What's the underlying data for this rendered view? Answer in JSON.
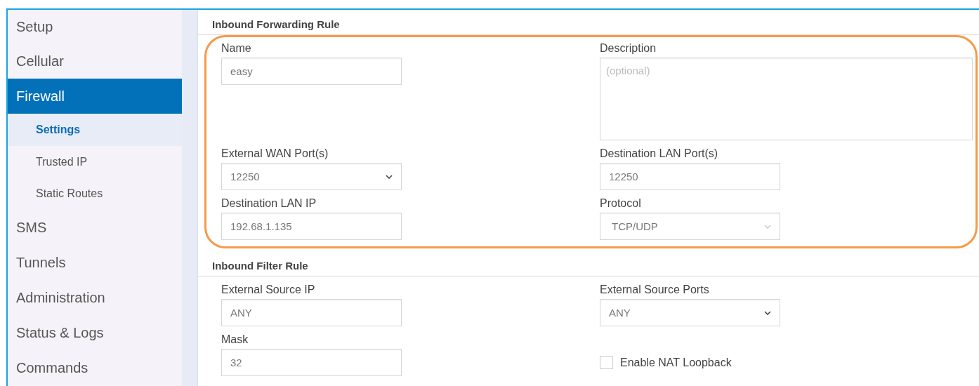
{
  "sidebar": {
    "items": [
      {
        "label": "Setup",
        "selected": false
      },
      {
        "label": "Cellular",
        "selected": false
      },
      {
        "label": "Firewall",
        "selected": true,
        "children": [
          {
            "label": "Settings",
            "selected": true
          },
          {
            "label": "Trusted IP",
            "selected": false
          },
          {
            "label": "Static Routes",
            "selected": false
          }
        ]
      },
      {
        "label": "SMS",
        "selected": false
      },
      {
        "label": "Tunnels",
        "selected": false
      },
      {
        "label": "Administration",
        "selected": false
      },
      {
        "label": "Status & Logs",
        "selected": false
      },
      {
        "label": "Commands",
        "selected": false
      }
    ]
  },
  "sections": [
    {
      "title": "Inbound Forwarding Rule",
      "highlighted": true,
      "fields": [
        {
          "kind": "text",
          "label": "Name",
          "value": "easy"
        },
        {
          "kind": "textarea",
          "label": "Description",
          "placeholder": "(optional)"
        },
        {
          "kind": "select",
          "label": "External WAN Port(s)",
          "value": "12250",
          "disabled": false
        },
        {
          "kind": "text",
          "label": "Destination LAN Port(s)",
          "value": "12250"
        },
        {
          "kind": "text",
          "label": "Destination LAN IP",
          "value": "192.68.1.135"
        },
        {
          "kind": "select",
          "label": "Protocol",
          "value": "TCP/UDP",
          "disabled": true
        }
      ]
    },
    {
      "title": "Inbound Filter Rule",
      "highlighted": false,
      "fields": [
        {
          "kind": "text",
          "label": "External Source IP",
          "value": "ANY"
        },
        {
          "kind": "select",
          "label": "External Source Ports",
          "value": "ANY",
          "disabled": false
        },
        {
          "kind": "text",
          "label": "Mask",
          "value": "32"
        },
        {
          "kind": "checkbox",
          "label": "Enable NAT Loopback",
          "checked": false
        }
      ]
    }
  ]
}
